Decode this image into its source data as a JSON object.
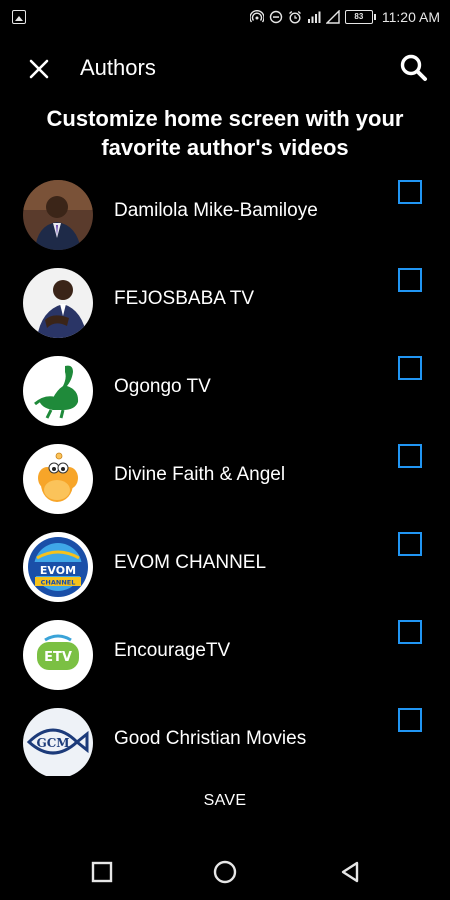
{
  "status_bar": {
    "battery": "83",
    "time": "11:20 AM"
  },
  "app_bar": {
    "title": "Authors",
    "close_icon": "close-icon",
    "search_icon": "search-icon"
  },
  "heading": "Customize home screen with your favorite author's videos",
  "authors": [
    {
      "name": "Damilola Mike-Bamiloye",
      "avatar": "person-avatar",
      "checked": false
    },
    {
      "name": "FEJOSBABA TV",
      "avatar": "person-avatar",
      "checked": false
    },
    {
      "name": "Ogongo TV",
      "avatar": "ogongo-logo",
      "checked": false
    },
    {
      "name": "Divine Faith & Angel",
      "avatar": "cartoon-logo",
      "checked": false
    },
    {
      "name": "EVOM CHANNEL",
      "avatar": "evom-logo",
      "checked": false,
      "logo_text": "EVOM",
      "logo_subtext": "CHANNEL"
    },
    {
      "name": "EncourageTV",
      "avatar": "etv-logo",
      "checked": false,
      "logo_text": "ETV"
    },
    {
      "name": "Good Christian Movies",
      "avatar": "gcm-logo",
      "checked": false,
      "logo_text": "GCM"
    }
  ],
  "save_label": "SAVE",
  "colors": {
    "background": "#000000",
    "checkbox_border": "#2196f3",
    "text": "#ffffff"
  }
}
